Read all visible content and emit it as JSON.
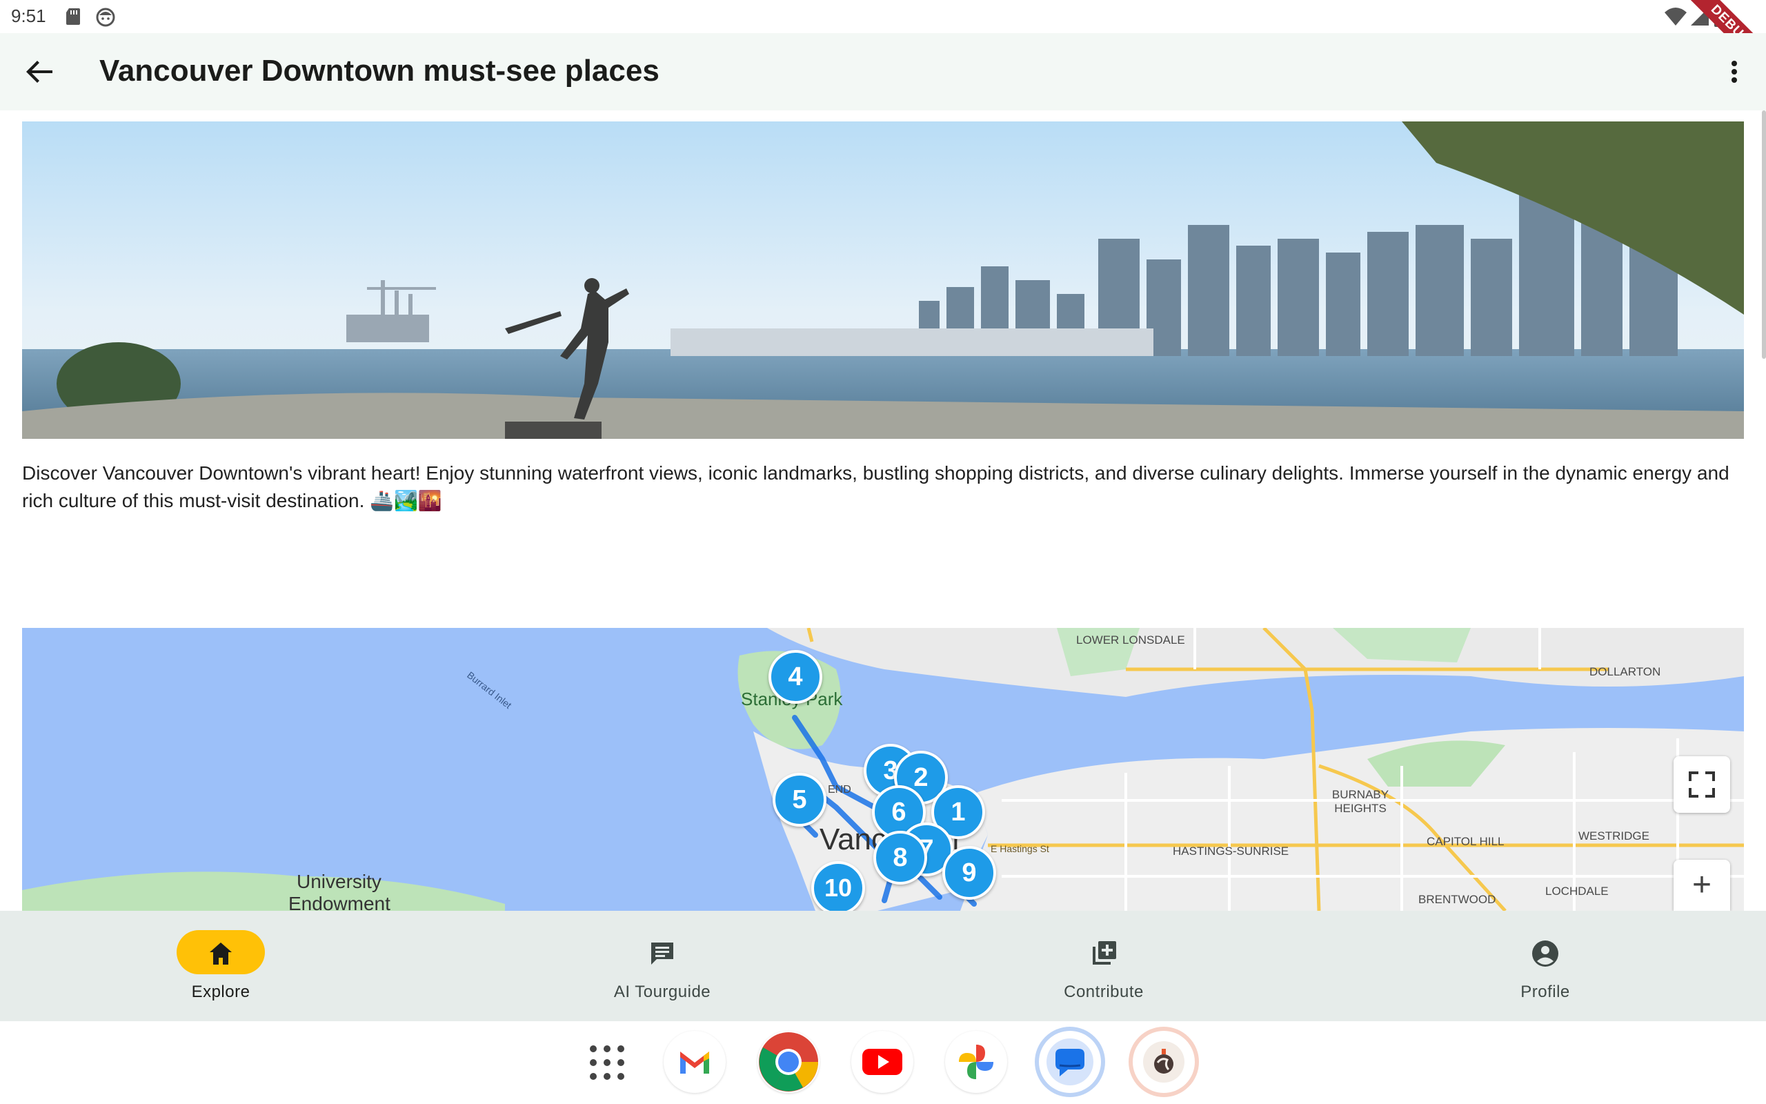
{
  "status_bar": {
    "time": "9:51",
    "debug_banner": "DEBUG",
    "icons": [
      "sd-card-icon",
      "face-icon",
      "wifi-icon",
      "signal-icon",
      "battery-icon"
    ]
  },
  "app_bar": {
    "title": "Vancouver Downtown must-see places",
    "back_icon": "arrow-back-icon",
    "menu_icon": "more-vert-icon"
  },
  "tour": {
    "description": "Discover Vancouver Downtown's vibrant heart! Enjoy stunning waterfront views, iconic landmarks, bustling shopping districts, and diverse culinary delights. Immerse yourself in the dynamic energy and rich culture of this must-visit destination. 🚢🏞️🌇"
  },
  "map": {
    "labels": {
      "lower_lonsdale": "LOWER LONSDALE",
      "dollarton": "DOLLARTON",
      "burrard_inlet": "Burrard Inlet",
      "stanley_park": "Stanley Park",
      "west_end": "END",
      "vancouver": "Vancouver",
      "burnaby_heights": "BURNABY HEIGHTS",
      "e_hastings": "E Hastings St",
      "hastings_sunrise": "HASTINGS-SUNRISE",
      "capitol_hill": "CAPITOL HILL",
      "westridge": "WESTRIDGE",
      "brentwood": "BRENTWOOD",
      "lochdale": "LOCHDALE",
      "university": "University",
      "endowment": "Endowment"
    },
    "markers": [
      "1",
      "2",
      "3",
      "4",
      "5",
      "6",
      "7",
      "8",
      "9",
      "10"
    ],
    "controls": {
      "zoom_in": "+",
      "fullscreen_icon": "fullscreen-icon"
    }
  },
  "bottom_nav": {
    "items": [
      {
        "label": "Explore",
        "icon": "home-icon",
        "active": true
      },
      {
        "label": "AI Tourguide",
        "icon": "chat-icon",
        "active": false
      },
      {
        "label": "Contribute",
        "icon": "library-add-icon",
        "active": false
      },
      {
        "label": "Profile",
        "icon": "account-circle-icon",
        "active": false
      }
    ]
  },
  "taskbar": {
    "apps": [
      "app-drawer-icon",
      "gmail-icon",
      "chrome-icon",
      "youtube-icon",
      "photos-icon",
      "messages-icon",
      "tour-app-icon"
    ]
  },
  "colors": {
    "accent": "#ffc107",
    "marker": "#1e9be8",
    "route": "#1a73e8",
    "water": "#9cc0f9"
  }
}
